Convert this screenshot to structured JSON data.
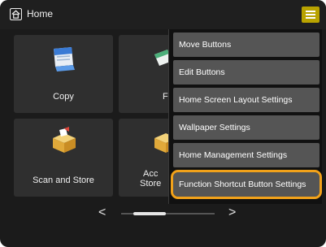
{
  "header": {
    "title": "Home",
    "home_icon": "home-icon",
    "menu_icon": "hamburger-menu-icon",
    "menu_color": "#b9a300"
  },
  "tiles": [
    {
      "label": "Copy",
      "icon": "copy-icon"
    },
    {
      "label": "Fa",
      "icon": "fax-icon"
    },
    {
      "label": "Scan and Store",
      "icon": "scan-store-icon"
    },
    {
      "label_line1": "Acc",
      "label_line2": "Store",
      "icon": "access-stored-icon"
    }
  ],
  "menu": {
    "items": [
      "Move Buttons",
      "Edit Buttons",
      "Home Screen Layout Settings",
      "Wallpaper Settings",
      "Home Management Settings",
      "Function Shortcut Button Settings"
    ],
    "highlighted_index": 5,
    "highlight_color": "#f2a21a"
  },
  "pager": {
    "prev": "<",
    "next": ">",
    "position_fraction": 0.2
  }
}
